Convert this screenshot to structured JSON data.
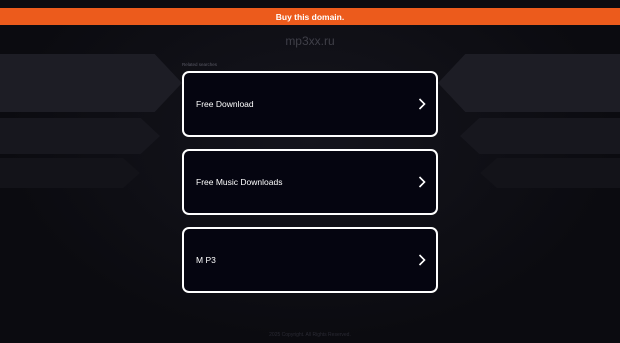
{
  "banner": {
    "label": "Buy this domain."
  },
  "site": {
    "domain": "mp3xx.ru"
  },
  "related": {
    "label": "Related searches",
    "items": [
      {
        "label": "Free Download",
        "icon": "chevron-right-icon"
      },
      {
        "label": "Free Music Downloads",
        "icon": "chevron-right-icon"
      },
      {
        "label": "M P3",
        "icon": "chevron-right-icon"
      }
    ]
  },
  "footer": {
    "text": "2025 Copyright. All Rights Reserved."
  },
  "colors": {
    "accent": "#ec5b1c",
    "background": "#0b0b10",
    "card": "#050510",
    "card_border": "#ffffff"
  }
}
